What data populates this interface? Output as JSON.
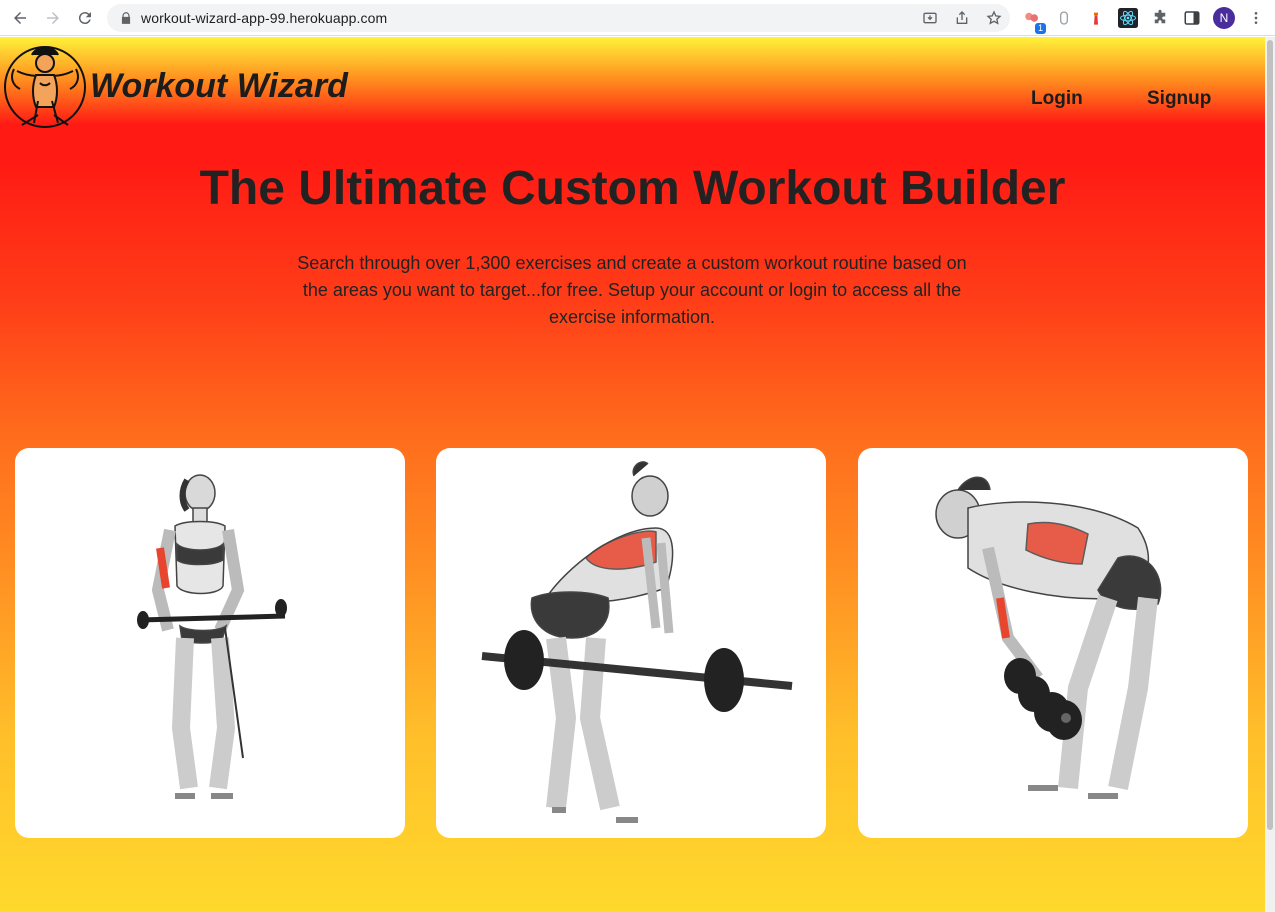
{
  "browser": {
    "url": "workout-wizard-app-99.herokuapp.com",
    "extension_badge": "1",
    "profile_initial": "N"
  },
  "header": {
    "brand": "Workout Wizard",
    "nav": {
      "login": "Login",
      "signup": "Signup"
    }
  },
  "hero": {
    "title": "The Ultimate Custom Workout Builder",
    "subtitle": "Search through over 1,300 exercises and create a custom workout routine based on the areas you want to target...for free. Setup your account or login to access all the exercise information."
  },
  "cards": [
    {
      "icon": "cable-curl-illustration"
    },
    {
      "icon": "barbell-row-illustration"
    },
    {
      "icon": "dumbbell-row-illustration"
    }
  ],
  "colors": {
    "gradient_top": "#fff23a",
    "gradient_red": "#ff1a14",
    "gradient_bottom": "#ffd92c",
    "muscle_highlight": "#e8452e"
  }
}
